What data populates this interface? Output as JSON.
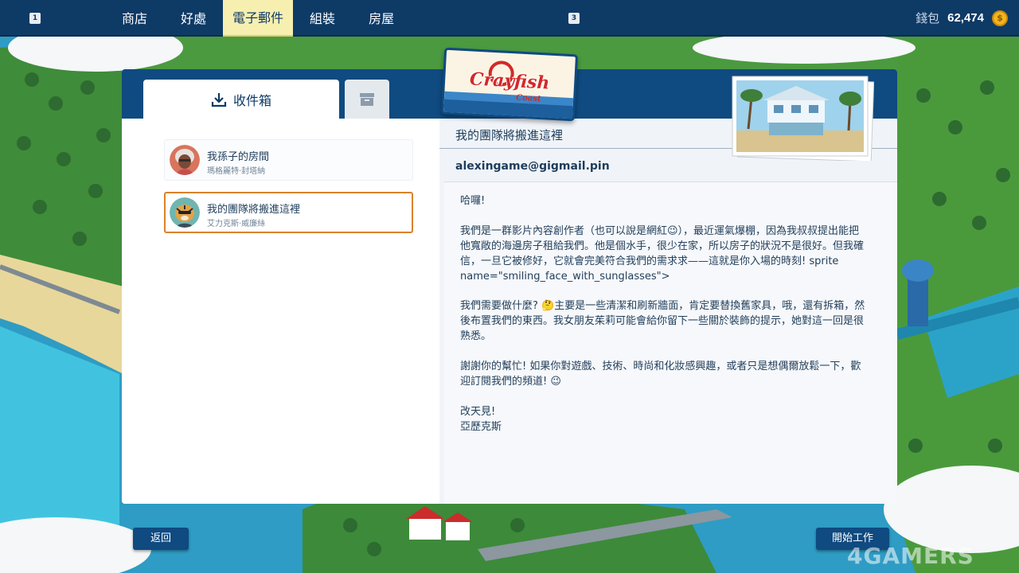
{
  "topbar": {
    "key_left": "1",
    "key_right": "3",
    "nav": [
      {
        "label": "商店"
      },
      {
        "label": "好處"
      },
      {
        "label": "電子郵件",
        "active": true
      },
      {
        "label": "組裝"
      },
      {
        "label": "房屋"
      }
    ],
    "wallet_label": "錢包",
    "wallet_amount": "62,474",
    "coin_icon": "coin-icon"
  },
  "mail": {
    "tabs": {
      "inbox_label": "收件箱",
      "inbox_icon": "download-tray-icon",
      "archive_icon": "archive-box-icon"
    },
    "messages": [
      {
        "subject": "我孫子的房間",
        "sender": "瑪格麗特·封塔納",
        "avatar": "grandmother-avatar"
      },
      {
        "subject": "我的團隊將搬進這裡",
        "sender": "艾力克斯·威廉絲",
        "avatar": "tiger-avatar",
        "selected": true
      }
    ],
    "reader": {
      "subject": "我的團隊將搬進這裡",
      "from": "alexingame@gigmail.pin",
      "greeting": "哈囉!",
      "p1": "我們是一群影片內容創作者（也可以說是網紅😉），最近運氣爆棚，因為我叔叔提出能把他寬敞的海邊房子租給我們。他是個水手，很少在家，所以房子的狀況不是很好。但我確信，一旦它被修好，它就會完美符合我們的需求求——這就是你入場的時刻! sprite name=\"smiling_face_with_sunglasses\">",
      "p2": "我們需要做什麼? 🤔主要是一些清潔和刷新牆面，肯定要替換舊家具，哦，還有拆箱，然後布置我們的東西。我女朋友茱莉可能會給你留下一些關於裝飾的提示，她對這一回是很熟悉。",
      "p3": "謝謝你的幫忙! 如果你對遊戲、技術、時尚和化妝感興趣，或者只是想偶爾放鬆一下，歡迎訂閱我們的頻道! 😉",
      "sign1": "改天見!",
      "sign2": "亞歷克斯"
    }
  },
  "branding": {
    "logo_main": "Crayfish",
    "logo_sub": "Coast",
    "photo": "beach-house-photo"
  },
  "buttons": {
    "back": "返回",
    "start": "開始工作"
  },
  "watermark": "4GAMERS",
  "colors": {
    "nav_bg": "#0e3a66",
    "active_tab": "#f6efb0",
    "panel_header": "#0f4a80",
    "selected_border": "#d9822b",
    "coin": "#f2b51c"
  }
}
